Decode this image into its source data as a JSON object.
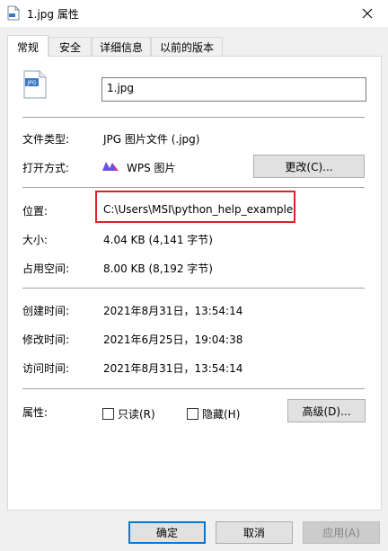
{
  "window": {
    "title": "1.jpg 属性"
  },
  "tabs": [
    {
      "label": "常规"
    },
    {
      "label": "安全"
    },
    {
      "label": "详细信息"
    },
    {
      "label": "以前的版本"
    }
  ],
  "file": {
    "name": "1.jpg",
    "icon": "jpg-file-icon",
    "icon_badge": "JPG"
  },
  "rows": {
    "type": {
      "label": "文件类型:",
      "value": "JPG 图片文件 (.jpg)"
    },
    "open_with": {
      "label": "打开方式:",
      "value": "WPS 图片",
      "button": "更改(C)..."
    },
    "location": {
      "label": "位置:",
      "value": "C:\\Users\\MSI\\python_help_example"
    },
    "size": {
      "label": "大小:",
      "value": "4.04 KB (4,141 字节)"
    },
    "disk_size": {
      "label": "占用空间:",
      "value": "8.00 KB (8,192 字节)"
    },
    "created": {
      "label": "创建时间:",
      "value": "2021年8月31日，13:54:14"
    },
    "modified": {
      "label": "修改时间:",
      "value": "2021年6月25日，19:04:38"
    },
    "accessed": {
      "label": "访问时间:",
      "value": "2021年8月31日，13:54:14"
    }
  },
  "attributes": {
    "label": "属性:",
    "readonly": "只读(R)",
    "hidden": "隐藏(H)",
    "advanced": "高级(D)..."
  },
  "footer": {
    "ok": "确定",
    "cancel": "取消",
    "apply": "应用(A)"
  },
  "colors": {
    "highlight": "#e0202a",
    "accent": "#0078d7"
  }
}
